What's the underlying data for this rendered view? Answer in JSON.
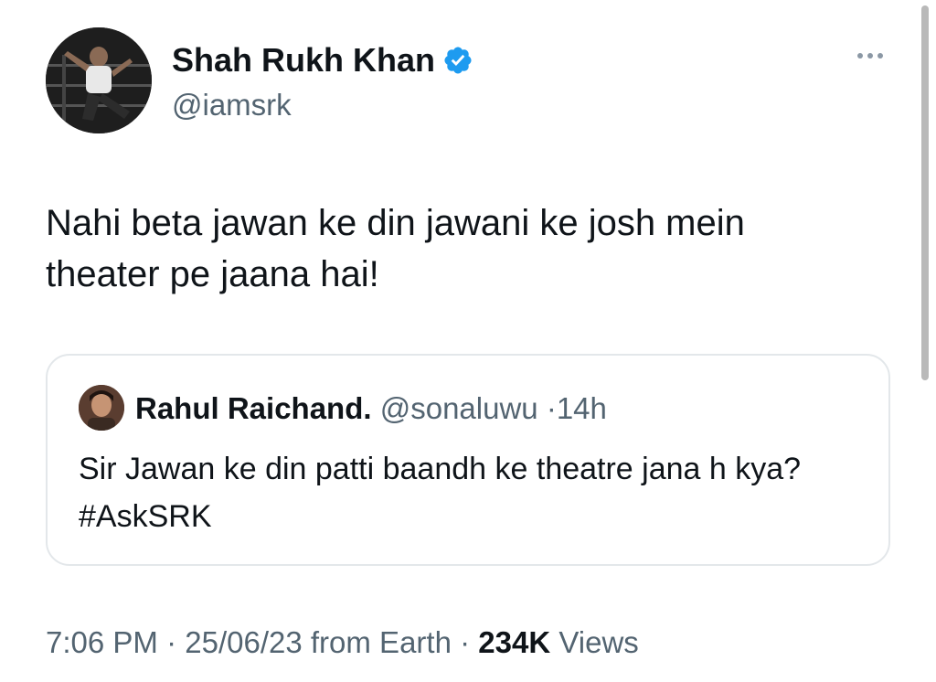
{
  "author": {
    "display_name": "Shah Rukh Khan",
    "handle": "@iamsrk",
    "verified_icon": "verified-badge-icon"
  },
  "tweet": {
    "text": "Nahi beta jawan ke din jawani ke josh mein theater pe jaana hai!"
  },
  "quoted_tweet": {
    "display_name": "Rahul Raichand.",
    "handle": "@sonaluwu",
    "separator": "·",
    "age": "14h",
    "text": "Sir Jawan ke din patti baandh ke theatre jana h kya? #AskSRK"
  },
  "meta": {
    "time": "7:06 PM",
    "sep1": "·",
    "date": "25/06/23",
    "source": "from Earth",
    "sep2": "·",
    "views_count": "234K",
    "views_label": "Views"
  },
  "colors": {
    "text": "#0f1419",
    "secondary": "#536471",
    "verified": "#1d9bf0",
    "border": "#e3e7ea"
  }
}
